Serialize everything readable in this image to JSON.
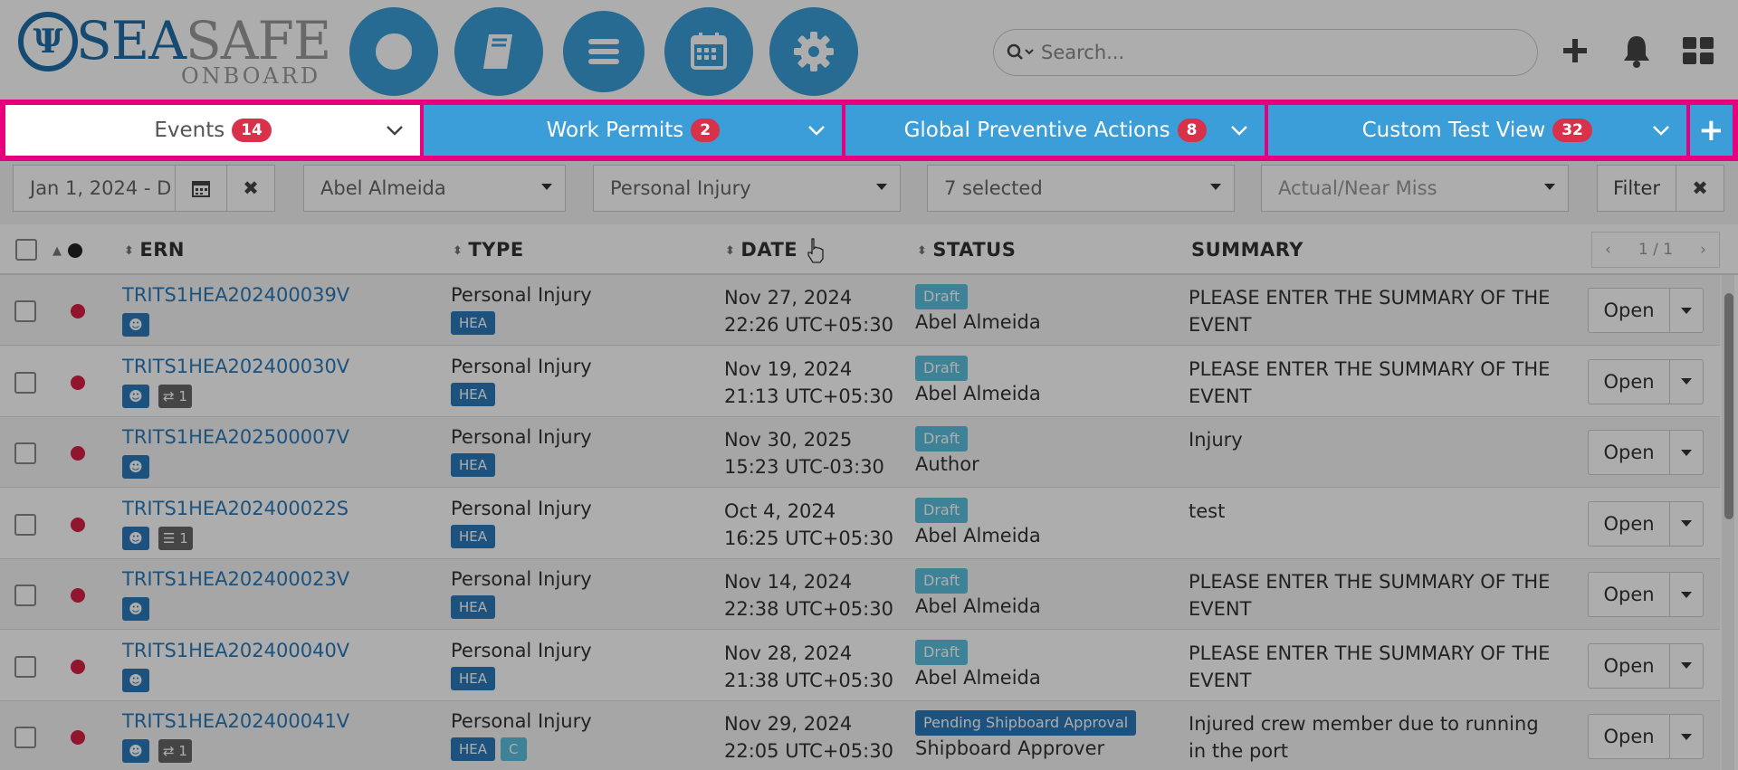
{
  "header": {
    "logo": {
      "sea": "SEA",
      "safe": "SAFE",
      "onboard": "ONBOARD",
      "mark": "Ψ"
    },
    "nav_icons": [
      "pie-chart-icon",
      "book-icon",
      "menu-icon",
      "calendar-icon",
      "gear-icon"
    ],
    "search": {
      "placeholder": "Search..."
    },
    "actions": [
      "plus-icon",
      "bell-icon",
      "grid-icon"
    ]
  },
  "tabs": [
    {
      "label": "Events",
      "count": "14",
      "active": true
    },
    {
      "label": "Work Permits",
      "count": "2",
      "active": false
    },
    {
      "label": "Global Preventive Actions",
      "count": "8",
      "active": false
    },
    {
      "label": "Custom Test View",
      "count": "32",
      "active": false
    }
  ],
  "tab_add_label": "+",
  "filters": {
    "date_range": "Jan 1, 2024 - D",
    "author": "Abel Almeida",
    "type": "Personal Injury",
    "status": "7 selected",
    "category_placeholder": "Actual/Near Miss",
    "filter_button": "Filter",
    "clear_glyph": "✖"
  },
  "table": {
    "columns": {
      "ern": "ERN",
      "type": "TYPE",
      "date": "DATE",
      "status": "STATUS",
      "summary": "SUMMARY"
    },
    "pager": "1 / 1",
    "open_label": "Open",
    "rows": [
      {
        "ern": "TRITS1HEA202400039V",
        "extra": "",
        "type": "Personal Injury",
        "tags": [
          "HEA"
        ],
        "date": "Nov 27, 2024",
        "time": "22:26 UTC+05:30",
        "status": "Draft",
        "who": "Abel Almeida",
        "summary": "PLEASE ENTER THE SUMMARY OF THE EVENT"
      },
      {
        "ern": "TRITS1HEA202400030V",
        "extra": "share:1",
        "type": "Personal Injury",
        "tags": [
          "HEA"
        ],
        "date": "Nov 19, 2024",
        "time": "21:13 UTC+05:30",
        "status": "Draft",
        "who": "Abel Almeida",
        "summary": "PLEASE ENTER THE SUMMARY OF THE EVENT"
      },
      {
        "ern": "TRITS1HEA202500007V",
        "extra": "",
        "type": "Personal Injury",
        "tags": [
          "HEA"
        ],
        "date": "Nov 30, 2025",
        "time": "15:23 UTC-03:30",
        "status": "Draft",
        "who": "Author",
        "summary": "Injury"
      },
      {
        "ern": "TRITS1HEA202400022S",
        "extra": "list:1",
        "type": "Personal Injury",
        "tags": [
          "HEA"
        ],
        "date": "Oct 4, 2024",
        "time": "16:25 UTC+05:30",
        "status": "Draft",
        "who": "Abel Almeida",
        "summary": "test"
      },
      {
        "ern": "TRITS1HEA202400023V",
        "extra": "",
        "type": "Personal Injury",
        "tags": [
          "HEA"
        ],
        "date": "Nov 14, 2024",
        "time": "22:38 UTC+05:30",
        "status": "Draft",
        "who": "Abel Almeida",
        "summary": "PLEASE ENTER THE SUMMARY OF THE EVENT"
      },
      {
        "ern": "TRITS1HEA202400040V",
        "extra": "",
        "type": "Personal Injury",
        "tags": [
          "HEA"
        ],
        "date": "Nov 28, 2024",
        "time": "21:38 UTC+05:30",
        "status": "Draft",
        "who": "Abel Almeida",
        "summary": "PLEASE ENTER THE SUMMARY OF THE EVENT"
      },
      {
        "ern": "TRITS1HEA202400041V",
        "extra": "share:1",
        "type": "Personal Injury",
        "tags": [
          "HEA",
          "C"
        ],
        "date": "Nov 29, 2024",
        "time": "22:05 UTC+05:30",
        "status": "Pending Shipboard Approval",
        "who": "Shipboard Approver",
        "summary": "Injured crew member due to running in the port"
      }
    ]
  },
  "colors": {
    "brand": "#3b9ed8",
    "highlight": "#e6007e",
    "badge": "#d9314a",
    "draft": "#5bc0de",
    "dot": "#d61f44"
  }
}
